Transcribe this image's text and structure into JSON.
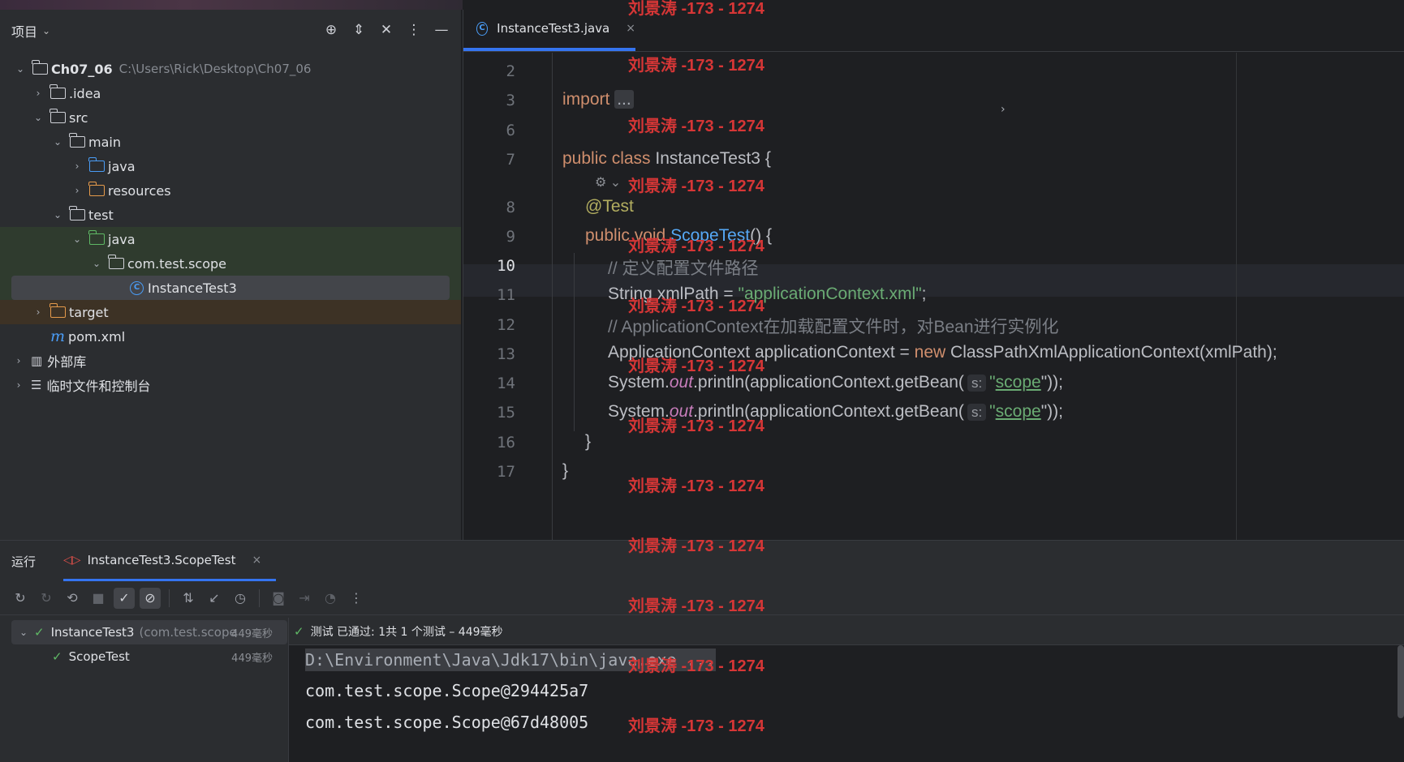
{
  "project_panel": {
    "title": "项目",
    "tree": [
      {
        "name": "Ch07_06",
        "path": "C:\\Users\\Rick\\Desktop\\Ch07_06"
      },
      {
        "name": ".idea"
      },
      {
        "name": "src"
      },
      {
        "name": "main"
      },
      {
        "name": "java"
      },
      {
        "name": "resources"
      },
      {
        "name": "test"
      },
      {
        "name": "java"
      },
      {
        "name": "com.test.scope"
      },
      {
        "name": "InstanceTest3"
      },
      {
        "name": "target"
      },
      {
        "name": "pom.xml"
      },
      {
        "name": "外部库"
      },
      {
        "name": "临时文件和控制台"
      }
    ]
  },
  "editor": {
    "tab": {
      "label": "InstanceTest3.java",
      "close": "×"
    },
    "line_numbers": [
      "2",
      "3",
      "6",
      "7",
      "8",
      "9",
      "10",
      "11",
      "12",
      "13",
      "14",
      "15",
      "16",
      "17"
    ],
    "code": {
      "import_kw": "import",
      "import_dots": "...",
      "l7_kw": "public class",
      "l7_name": "InstanceTest3 {",
      "l8": "@Test",
      "l9_kw": "public void",
      "l9_fn": "ScopeTest",
      "l9_rest": "() {",
      "l10": "// 定义配置文件路径",
      "l11_a": "String xmlPath = ",
      "l11_str": "\"applicationContext.xml\"",
      "l11_b": ";",
      "l12": "// ApplicationContext在加载配置文件时，对Bean进行实例化",
      "l13_a": "ApplicationContext applicationContext = ",
      "l13_kw": "new",
      "l13_b": " ClassPathXmlApplicationContext(xmlPath);",
      "sys": "System.",
      "out": "out",
      "println": ".println(applicationContext.getBean(",
      "hint": "s:",
      "q": "\"",
      "scope": "scope",
      "end": "\"));",
      "close_method": "}",
      "close_class": "}"
    }
  },
  "run_panel": {
    "title": "运行",
    "tab_label": "InstanceTest3.ScopeTest",
    "tab_close": "×",
    "tree": [
      {
        "name": "InstanceTest3",
        "pkg": "(com.test.scope",
        "time": "449毫秒"
      },
      {
        "name": "ScopeTest",
        "time": "449毫秒"
      }
    ],
    "status": "测试 已通过: 1共 1 个测试 – 449毫秒",
    "console": [
      "D:\\Environment\\Java\\Jdk17\\bin\\java.exe ...",
      "com.test.scope.Scope@294425a7",
      "com.test.scope.Scope@67d48005"
    ]
  },
  "watermark": "刘景涛 -173 - 1274"
}
